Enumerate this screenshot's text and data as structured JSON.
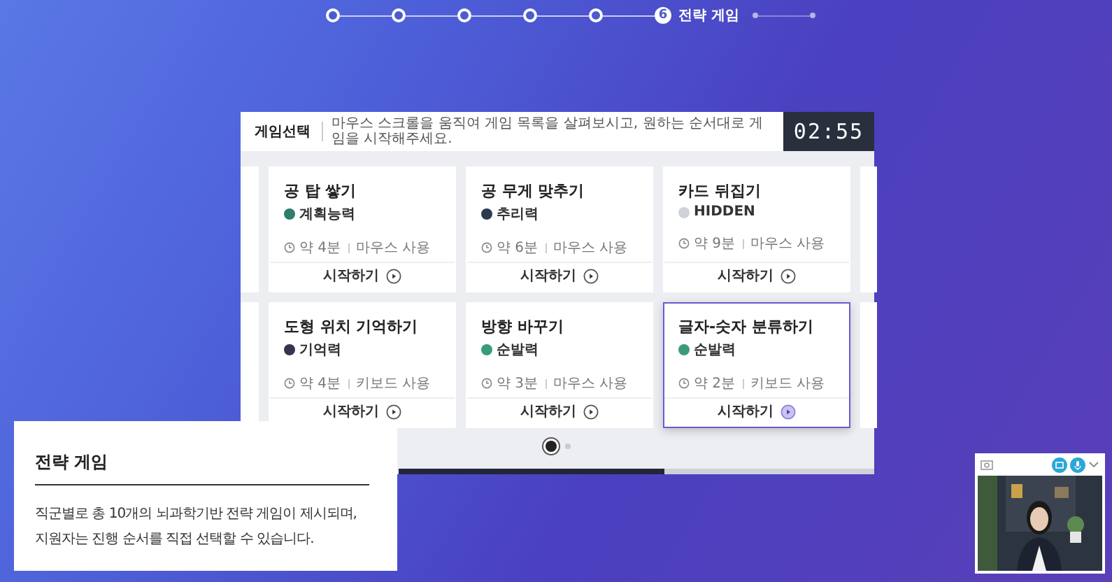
{
  "stepper": {
    "steps": [
      {
        "kind": "done"
      },
      {
        "kind": "done"
      },
      {
        "kind": "done"
      },
      {
        "kind": "done"
      },
      {
        "kind": "done"
      },
      {
        "kind": "current",
        "number": "6",
        "label": "전략 게임"
      },
      {
        "kind": "upcoming"
      },
      {
        "kind": "upcoming"
      }
    ]
  },
  "panel": {
    "title": "게임선택",
    "instruction": "마우스 스크롤을 움직여 게임 목록을 살펴보시고, 원하는 순서대로 게임을 시작해주세요.",
    "timer": "02:55",
    "games": [
      {
        "title": "공 탑 쌓기",
        "skill": "계획능력",
        "color": "#2e7d6e",
        "time": "약 4분",
        "input": "마우스 사용",
        "action": "시작하기",
        "selected": false
      },
      {
        "title": "공 무게 맞추기",
        "skill": "추리력",
        "color": "#2b3a4f",
        "time": "약 6분",
        "input": "마우스 사용",
        "action": "시작하기",
        "selected": false
      },
      {
        "title": "카드 뒤집기",
        "skill": "HIDDEN",
        "color": "#cfd2d6",
        "time": "약 9분",
        "input": "마우스 사용",
        "action": "시작하기",
        "selected": false
      },
      {
        "title": "도형 위치 기억하기",
        "skill": "기억력",
        "color": "#3a3350",
        "time": "약 4분",
        "input": "키보드 사용",
        "action": "시작하기",
        "selected": false
      },
      {
        "title": "방향 바꾸기",
        "skill": "순발력",
        "color": "#3a9a7e",
        "time": "약 3분",
        "input": "마우스 사용",
        "action": "시작하기",
        "selected": false
      },
      {
        "title": "글자-숫자 분류하기",
        "skill": "순발력",
        "color": "#3a9a7e",
        "time": "약 2분",
        "input": "키보드 사용",
        "action": "시작하기",
        "selected": true
      }
    ],
    "pages": [
      {
        "selected": true
      },
      {
        "selected": false
      }
    ]
  },
  "info": {
    "title": "전략 게임",
    "text": "직군별로 총 10개의 뇌과학기반 전략 게임이 제시되며,\n지원자는 진행 순서를 직접 선택할 수 있습니다."
  }
}
